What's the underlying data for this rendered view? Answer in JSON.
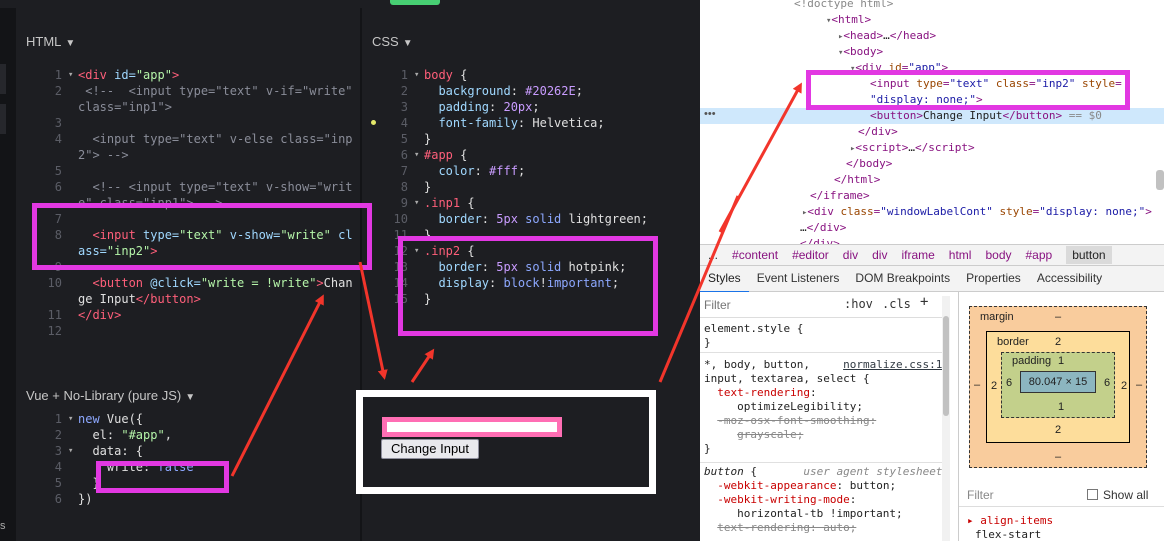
{
  "top_strip": {
    "text": "",
    "text_right": ""
  },
  "html_panel": {
    "title": "HTML",
    "lines": [
      {
        "n": "1",
        "fold": true,
        "parts": [
          [
            "tag",
            "<div "
          ],
          [
            "attr",
            "id="
          ],
          [
            "str",
            "\"app\""
          ],
          [
            "tag",
            ">"
          ]
        ]
      },
      {
        "n": "2",
        "fold": false,
        "parts": [
          [
            "com",
            " <!--  <input type=\"text\" v-if=\"write\""
          ]
        ]
      },
      {
        "n": "",
        "fold": false,
        "parts": [
          [
            "com",
            "class=\"inp1\">"
          ]
        ]
      },
      {
        "n": "3",
        "fold": false,
        "parts": [
          [
            "txt",
            ""
          ]
        ]
      },
      {
        "n": "4",
        "fold": false,
        "parts": [
          [
            "com",
            "  <input type=\"text\" v-else class=\"inp"
          ]
        ]
      },
      {
        "n": "",
        "fold": false,
        "parts": [
          [
            "com",
            "2\"> -->"
          ]
        ]
      },
      {
        "n": "5",
        "fold": false,
        "parts": [
          [
            "txt",
            ""
          ]
        ]
      },
      {
        "n": "6",
        "fold": false,
        "parts": [
          [
            "com",
            "  <!-- <input type=\"text\" v-show=\"writ"
          ]
        ]
      },
      {
        "n": "",
        "fold": false,
        "parts": [
          [
            "com",
            "e\" class=\"inp1\"> -->"
          ]
        ]
      },
      {
        "n": "7",
        "fold": false,
        "parts": [
          [
            "txt",
            ""
          ]
        ]
      },
      {
        "n": "8",
        "fold": false,
        "parts": [
          [
            "tag",
            "  <input "
          ],
          [
            "attr",
            "type="
          ],
          [
            "str",
            "\"text\" "
          ],
          [
            "attr",
            "v-show="
          ],
          [
            "str",
            "\"write\" "
          ],
          [
            "attr",
            "cl"
          ]
        ]
      },
      {
        "n": "",
        "fold": false,
        "parts": [
          [
            "attr",
            "ass="
          ],
          [
            "str",
            "\"inp2\""
          ],
          [
            "tag",
            ">"
          ]
        ]
      },
      {
        "n": "9",
        "fold": false,
        "parts": [
          [
            "txt",
            ""
          ]
        ]
      },
      {
        "n": "10",
        "fold": false,
        "parts": [
          [
            "tag",
            "  <button "
          ],
          [
            "attr",
            "@click="
          ],
          [
            "str",
            "\"write = !write\""
          ],
          [
            "tag",
            ">"
          ],
          [
            "txt",
            "Chan"
          ]
        ]
      },
      {
        "n": "",
        "fold": false,
        "parts": [
          [
            "txt",
            "ge Input"
          ],
          [
            "tag",
            "</button>"
          ]
        ]
      },
      {
        "n": "11",
        "fold": false,
        "parts": [
          [
            "tag",
            "</div>"
          ]
        ]
      },
      {
        "n": "12",
        "fold": false,
        "parts": [
          [
            "txt",
            ""
          ]
        ]
      }
    ]
  },
  "css_panel": {
    "title": "CSS",
    "lines": [
      {
        "n": "1",
        "fold": true,
        "parts": [
          [
            "tag",
            "body "
          ],
          [
            "txt",
            "{"
          ]
        ]
      },
      {
        "n": "2",
        "fold": false,
        "parts": [
          [
            "prop",
            "  background"
          ],
          [
            "txt",
            ": "
          ],
          [
            "hex",
            "#20262E"
          ],
          [
            "txt",
            ";"
          ]
        ]
      },
      {
        "n": "3",
        "fold": false,
        "parts": [
          [
            "prop",
            "  padding"
          ],
          [
            "txt",
            ": "
          ],
          [
            "num",
            "20px"
          ],
          [
            "txt",
            ";"
          ]
        ]
      },
      {
        "n": "4",
        "fold": false,
        "warn": true,
        "parts": [
          [
            "prop",
            "  font-family"
          ],
          [
            "txt",
            ": Helvetica;"
          ]
        ]
      },
      {
        "n": "5",
        "fold": false,
        "parts": [
          [
            "txt",
            "}"
          ]
        ]
      },
      {
        "n": "6",
        "fold": true,
        "parts": [
          [
            "tag",
            "#app "
          ],
          [
            "txt",
            "{"
          ]
        ]
      },
      {
        "n": "7",
        "fold": false,
        "parts": [
          [
            "prop",
            "  color"
          ],
          [
            "txt",
            ": "
          ],
          [
            "hex",
            "#fff"
          ],
          [
            "txt",
            ";"
          ]
        ]
      },
      {
        "n": "8",
        "fold": false,
        "parts": [
          [
            "txt",
            "}"
          ]
        ]
      },
      {
        "n": "9",
        "fold": true,
        "parts": [
          [
            "tag",
            ".inp1 "
          ],
          [
            "txt",
            "{"
          ]
        ]
      },
      {
        "n": "10",
        "fold": false,
        "parts": [
          [
            "prop",
            "  border"
          ],
          [
            "txt",
            ": "
          ],
          [
            "num",
            "5px"
          ],
          [
            "kw",
            " solid"
          ],
          [
            "txt",
            " lightgreen;"
          ]
        ]
      },
      {
        "n": "11",
        "fold": false,
        "parts": [
          [
            "txt",
            "}"
          ]
        ]
      },
      {
        "n": "12",
        "fold": true,
        "parts": [
          [
            "tag",
            ".inp2 "
          ],
          [
            "txt",
            "{"
          ]
        ]
      },
      {
        "n": "13",
        "fold": false,
        "parts": [
          [
            "prop",
            "  border"
          ],
          [
            "txt",
            ": "
          ],
          [
            "num",
            "5px"
          ],
          [
            "kw",
            " solid"
          ],
          [
            "txt",
            " hotpink;"
          ]
        ]
      },
      {
        "n": "14",
        "fold": false,
        "parts": [
          [
            "prop",
            "  display"
          ],
          [
            "txt",
            ": "
          ],
          [
            "kw",
            "block"
          ],
          [
            "txt",
            "!"
          ],
          [
            "kw",
            "important"
          ],
          [
            "txt",
            ";"
          ]
        ]
      },
      {
        "n": "15",
        "fold": false,
        "parts": [
          [
            "txt",
            "}"
          ]
        ]
      }
    ]
  },
  "js_panel": {
    "title": "Vue + No-Library (pure JS)",
    "lines": [
      {
        "n": "1",
        "fold": true,
        "parts": [
          [
            "kw",
            "new "
          ],
          [
            "txt",
            "Vue({"
          ]
        ]
      },
      {
        "n": "2",
        "fold": false,
        "parts": [
          [
            "txt",
            "  el: "
          ],
          [
            "str",
            "\"#app\""
          ],
          [
            "txt",
            ","
          ]
        ]
      },
      {
        "n": "3",
        "fold": true,
        "parts": [
          [
            "txt",
            "  data: {"
          ]
        ]
      },
      {
        "n": "4",
        "fold": false,
        "parts": [
          [
            "txt",
            "    write: "
          ],
          [
            "kw",
            "false"
          ]
        ]
      },
      {
        "n": "5",
        "fold": false,
        "parts": [
          [
            "txt",
            "  }"
          ]
        ]
      },
      {
        "n": "6",
        "fold": false,
        "parts": [
          [
            "txt",
            "})"
          ]
        ]
      }
    ]
  },
  "preview": {
    "button_label": "Change Input"
  },
  "devtools": {
    "elements": [
      {
        "indent": 94,
        "html": "<span class='cm'>&lt;!doctype html&gt;</span>"
      },
      {
        "indent": 126,
        "html": "<span class='tri'>▾</span>&lt;html&gt;"
      },
      {
        "indent": 138,
        "html": "<span class='tri'>▸</span>&lt;head&gt;<span class='tx'>…</span>&lt;/head&gt;"
      },
      {
        "indent": 138,
        "html": "<span class='tri'>▾</span>&lt;body&gt;"
      },
      {
        "indent": 150,
        "html": "<span class='tri'>▾</span>&lt;div <span class='an'>id</span>=<span class='av'>\"app\"</span>&gt;"
      },
      {
        "indent": 170,
        "html": "&lt;input <span class='an'>type</span>=<span class='av'>\"text\"</span> <span class='an'>class</span>=<span class='av'>\"inp2\"</span> <span class='an'>style</span>="
      },
      {
        "indent": 170,
        "html": "<span class='av'>\"display: none;\"</span>&gt;"
      },
      {
        "indent": 170,
        "html": "&lt;button&gt;<span class='tx'>Change Input</span>&lt;/button&gt; <span class='cm'>== $0</span>"
      },
      {
        "indent": 158,
        "html": "&lt;/div&gt;"
      },
      {
        "indent": 150,
        "html": "<span class='tri'>▸</span>&lt;script&gt;<span class='tx'>…</span>&lt;/script&gt;"
      },
      {
        "indent": 146,
        "html": "&lt;/body&gt;"
      },
      {
        "indent": 134,
        "html": "&lt;/html&gt;"
      },
      {
        "indent": 110,
        "html": "&lt;/iframe&gt;"
      },
      {
        "indent": 102,
        "html": "<span class='tri'>▸</span>&lt;div <span class='an'>class</span>=<span class='av'>\"windowLabelCont\"</span> <span class='an'>style</span>=<span class='av'>\"display: none;\"</span>&gt;"
      },
      {
        "indent": 100,
        "html": "<span class='tx'>…</span>&lt;/div&gt;"
      }
    ],
    "breadcrumbs": [
      "...",
      "#content",
      "#editor",
      "div",
      "div",
      "iframe",
      "html",
      "body",
      "#app",
      "button"
    ],
    "tabs": [
      "Styles",
      "Event Listeners",
      "DOM Breakpoints",
      "Properties",
      "Accessibility"
    ],
    "filter_placeholder": "Filter",
    "hov": ":hov",
    "cls": ".cls",
    "plus": "+",
    "boxmodel": {
      "margin_label": "margin",
      "margin": "–",
      "border_label": "border",
      "border": "2",
      "padding_label": "padding",
      "padding": "1",
      "content": "80.047 × 15",
      "left_margin": "–",
      "left_border": "2",
      "left_padding": "6",
      "right_padding": "6",
      "right_border": "2",
      "right_margin": "–",
      "bottom_padding": "1",
      "bottom_border": "2",
      "bottom_margin": "–",
      "filter": "Filter",
      "show_all": "Show all",
      "prop": "▸ align-items",
      "prop_val": "flex-start"
    }
  },
  "colors": {
    "highlight": "#e238e2",
    "arrow": "#f2352b",
    "hotpink": "#ff6eb4"
  }
}
